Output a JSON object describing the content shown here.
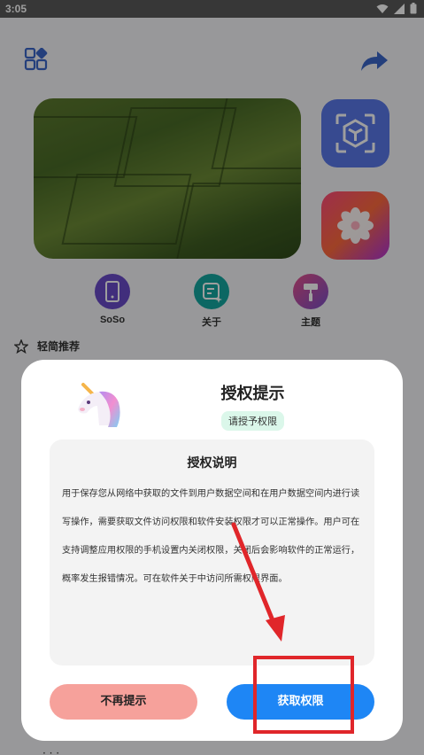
{
  "status_bar": {
    "time": "3:05",
    "icons": [
      "wifi-icon",
      "signal-icon",
      "battery-icon"
    ]
  },
  "background_app": {
    "shortcuts": [
      {
        "label": "SoSo",
        "icon": "phone-icon",
        "color": "#6a4bc8"
      },
      {
        "label": "关于",
        "icon": "edit-sparkle-icon",
        "color": "#14a7a0"
      },
      {
        "label": "主题",
        "icon": "paint-roller-icon",
        "color": "#d6497a"
      }
    ],
    "section_title": "轻简推荐",
    "bottom_partial": "· · ·"
  },
  "dialog": {
    "title": "授权提示",
    "badge": "请授予权限",
    "card_title": "授权说明",
    "card_lines": [
      "用于保存您从网络中获取的文件到用户数据空间和在用户数据空间内进行读",
      "写操作，需要获取文件访问权限和软件安装权限才可以正常操作。用户可在",
      "支持调整应用权限的手机设置内关闭权限，关闭后会影响软件的正常运行，",
      "概率发生报错情况。可在软件关于中访问所需权限界面。"
    ],
    "button_decline": "不再提示",
    "button_accept": "获取权限"
  },
  "colors": {
    "accent": "#1e86f5",
    "decline": "#f6a19b",
    "badge_bg": "#dbf7ea",
    "annotation": "#e0262a"
  }
}
